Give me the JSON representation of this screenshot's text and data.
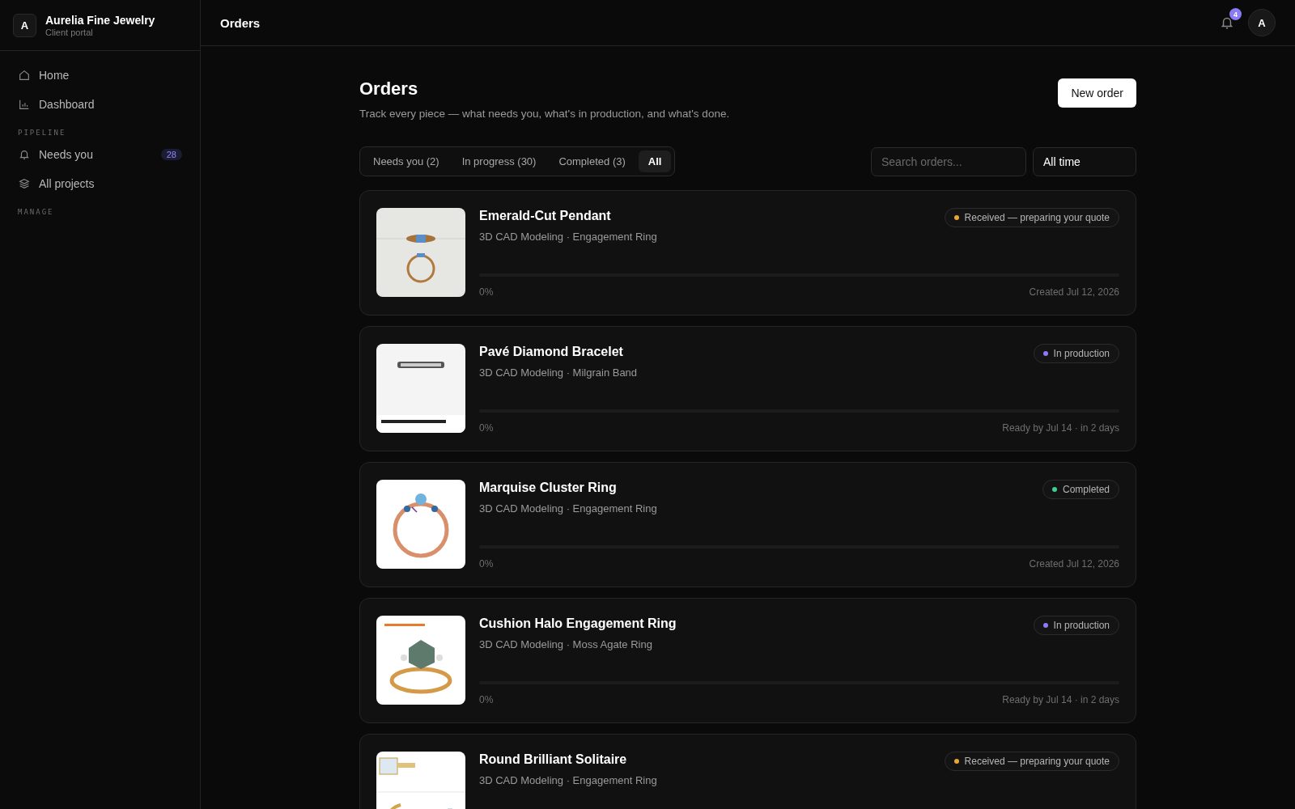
{
  "brand": {
    "initial": "A",
    "name": "Aurelia Fine Jewelry",
    "subtitle": "Client portal"
  },
  "sidebar": {
    "sections": [
      {
        "items": [
          {
            "label": "Home",
            "selected": false
          },
          {
            "label": "Dashboard",
            "selected": false
          }
        ]
      },
      {
        "heading": "PIPELINE",
        "items": [
          {
            "label": "Needs you",
            "badge": "28",
            "selected": false
          },
          {
            "label": "All projects",
            "selected": false
          }
        ]
      },
      {
        "heading": "MANAGE"
      }
    ]
  },
  "topbar": {
    "title": "Orders",
    "notifications": "4",
    "avatar": "A"
  },
  "page": {
    "title": "Orders",
    "subtitle": "Track every piece — what needs you, what's in production, and what's done.",
    "new_button": "New order"
  },
  "filters": [
    {
      "label": "Needs you (2)",
      "selected": false
    },
    {
      "label": "In progress (30)",
      "selected": false
    },
    {
      "label": "Completed (3)",
      "selected": false
    },
    {
      "label": "All",
      "selected": true
    }
  ],
  "search": {
    "placeholder": "Search orders..."
  },
  "period": {
    "value": "All time"
  },
  "orders": [
    {
      "title": "Emerald-Cut Pendant",
      "meta": "3D CAD Modeling · Engagement Ring",
      "status": "Received — preparing your quote",
      "color": "#e9a630",
      "level": 0,
      "percent": "0%",
      "date": "Created Jul 12, 2026"
    },
    {
      "title": "Pavé Diamond Bracelet",
      "meta": "3D CAD Modeling · Milgrain Band",
      "status": "In production",
      "color": "#8b7cf6",
      "level": 0,
      "percent": "0%",
      "date": "Ready by Jul 14 · in 2 days"
    },
    {
      "title": "Marquise Cluster Ring",
      "meta": "3D CAD Modeling · Engagement Ring",
      "status": "Completed",
      "color": "#3ecf8e",
      "level": 0,
      "percent": "0%",
      "date": "Created Jul 12, 2026"
    },
    {
      "title": "Cushion Halo Engagement Ring",
      "meta": "3D CAD Modeling · Moss Agate Ring",
      "status": "In production",
      "color": "#8b7cf6",
      "level": 0,
      "percent": "0%",
      "date": "Ready by Jul 14 · in 2 days"
    },
    {
      "title": "Round Brilliant Solitaire",
      "meta": "3D CAD Modeling · Engagement Ring",
      "status": "Received — preparing your quote",
      "color": "#e9a630"
    }
  ]
}
